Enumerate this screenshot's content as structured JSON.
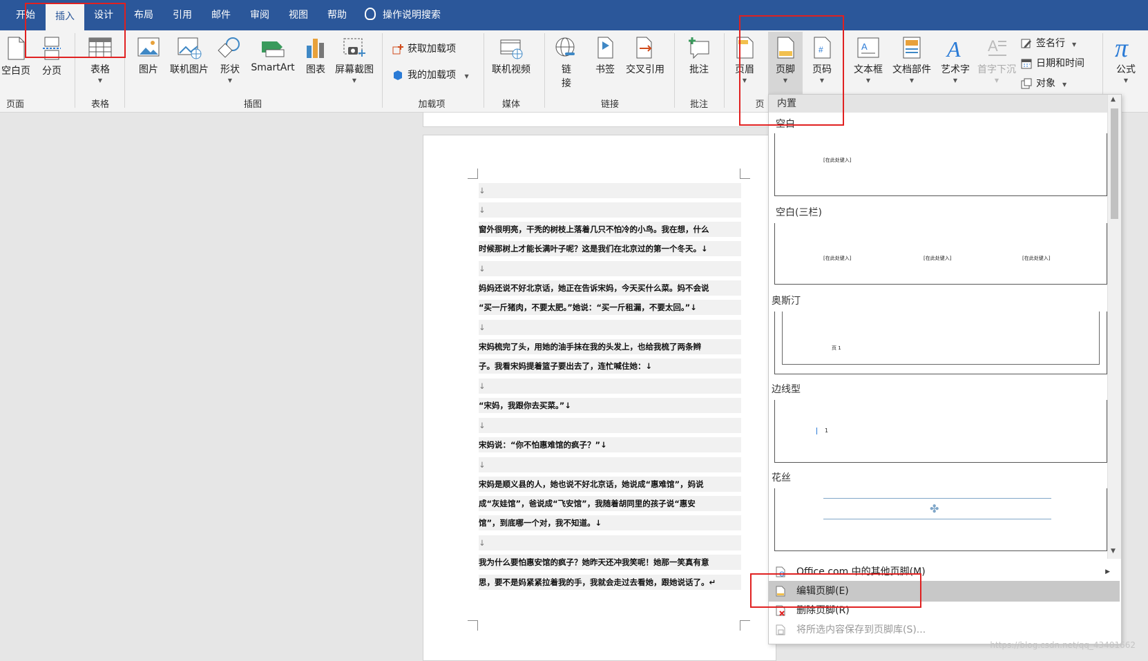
{
  "tabs": [
    {
      "label": "开始",
      "active": false
    },
    {
      "label": "插入",
      "active": true
    },
    {
      "label": "设计",
      "active": false
    },
    {
      "label": "布局",
      "active": false
    },
    {
      "label": "引用",
      "active": false
    },
    {
      "label": "邮件",
      "active": false
    },
    {
      "label": "审阅",
      "active": false
    },
    {
      "label": "视图",
      "active": false
    },
    {
      "label": "帮助",
      "active": false
    }
  ],
  "tell_me": "操作说明搜索",
  "ribbon": {
    "blank_page": "空白页",
    "page_break": "分页",
    "table": "表格",
    "picture": "图片",
    "online_picture": "联机图片",
    "shapes": "形状",
    "smartart": "SmartArt",
    "chart": "图表",
    "screenshot": "屏幕截图",
    "get_addins": "获取加载项",
    "my_addins": "我的加载项",
    "online_video": "联机视频",
    "link": "链\n接",
    "link_top": "链",
    "link_bottom": "接",
    "bookmark": "书签",
    "cross_ref": "交叉引用",
    "comment": "批注",
    "header": "页眉",
    "footer": "页脚",
    "page_number": "页码",
    "textbox": "文本框",
    "quick_parts": "文档部件",
    "wordart": "艺术字",
    "dropcap": "首字下沉",
    "signature_line": "签名行",
    "date_time": "日期和时间",
    "object": "对象",
    "equation": "公式",
    "groups": {
      "pages": "页面",
      "tables": "表格",
      "illustrations": "插图",
      "addins": "加载项",
      "media": "媒体",
      "links": "链接",
      "comments": "批注",
      "header_footer": "页"
    }
  },
  "document": {
    "paragraphs": [
      "↓",
      "↓",
      "        窗外很明亮，干秃的树枝上落着几只不怕冷的小鸟。我在想，什么",
      "时候那树上才能长满叶子呢？这是我们在北京过的第一个冬天。↓",
      "↓",
      "        妈妈还说不好北京话，她正在告诉宋妈，今天买什么菜。妈不会说",
      "“买一斤猪肉，不要太肥。”她说：“买一斤租漏，不要太回。”↓",
      "↓",
      "        宋妈梳完了头，用她的油手抹在我的头发上，也给我梳了两条辫",
      "子。我看宋妈提着篮子要出去了，连忙喊住她：↓",
      "↓",
      "        “宋妈，我跟你去买菜。”↓",
      "↓",
      "        宋妈说：“你不怕惠难馆的疯子？”↓",
      "↓",
      "        宋妈是顺义县的人，她也说不好北京话，她说成“惠难馆”，妈说",
      "成“灰娃馆”，爸说成“飞安馆”，我随着胡同里的孩子说“惠安",
      "馆”，到底哪一个对，我不知道。↓",
      "↓",
      "        我为什么要怕惠安馆的疯子？她昨天还冲我笑呢！她那一笑真有意",
      "思，要不是妈紧紧拉着我的手，我就会走过去看她，跟她说话了。↵"
    ]
  },
  "gallery": {
    "section": "内置",
    "items": [
      {
        "title": "空白",
        "placeholders": [
          "[在此处键入]"
        ]
      },
      {
        "title": "空白(三栏)",
        "placeholders": [
          "[在此处键入]",
          "[在此处键入]",
          "[在此处键入]"
        ]
      },
      {
        "title": "奥斯汀",
        "placeholders": [
          "页 1"
        ]
      },
      {
        "title": "边线型",
        "placeholders": [
          "1"
        ]
      },
      {
        "title": "花丝",
        "placeholders": []
      }
    ],
    "menu": [
      {
        "label": "Office.com 中的其他页脚(M)",
        "state": "normal"
      },
      {
        "label": "编辑页脚(E)",
        "state": "highlighted"
      },
      {
        "label": "删除页脚(R)",
        "state": "normal"
      },
      {
        "label": "将所选内容保存到页脚库(S)...",
        "state": "disabled"
      }
    ]
  },
  "watermark": "https://blog.csdn.net/qq_43401662",
  "colors": {
    "accent": "#2b579a",
    "highlight": "#e02020"
  }
}
